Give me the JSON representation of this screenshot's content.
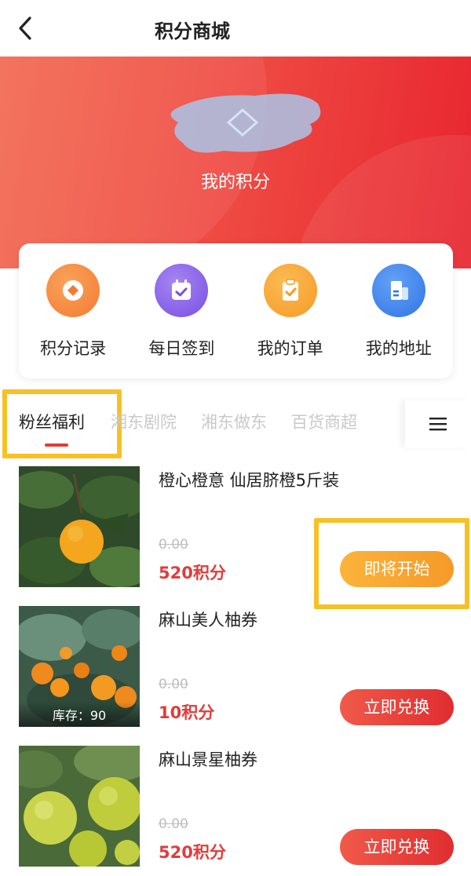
{
  "header": {
    "title": "积分商城",
    "back_icon": "chevron-left-icon"
  },
  "hero": {
    "label": "我的积分",
    "colors": {
      "start": "#f26a52",
      "end": "#e8252f"
    }
  },
  "quick_actions": [
    {
      "label": "积分记录",
      "icon": "points-record-icon",
      "color": "#f6843c"
    },
    {
      "label": "每日签到",
      "icon": "calendar-checkin-icon",
      "color": "#8a63e8"
    },
    {
      "label": "我的订单",
      "icon": "clipboard-order-icon",
      "color": "#f7a233"
    },
    {
      "label": "我的地址",
      "icon": "building-address-icon",
      "color": "#3f86ef"
    }
  ],
  "tabs": [
    {
      "label": "粉丝福利",
      "active": true
    },
    {
      "label": "湘东剧院",
      "active": false
    },
    {
      "label": "湘东做东",
      "active": false
    },
    {
      "label": "百货商超",
      "active": false
    }
  ],
  "menu_icon": "menu-icon",
  "products": [
    {
      "name": "橙心橙意 仙居脐橙5斤装",
      "original_price": "0.00",
      "points": "520积分",
      "button": "即将开始",
      "stock": ""
    },
    {
      "name": "麻山美人柚券",
      "original_price": "0.00",
      "points": "10积分",
      "button": "立即兑换",
      "stock": "库存：90"
    },
    {
      "name": "麻山景星柚券",
      "original_price": "0.00",
      "points": "520积分",
      "button": "立即兑换",
      "stock": ""
    }
  ]
}
